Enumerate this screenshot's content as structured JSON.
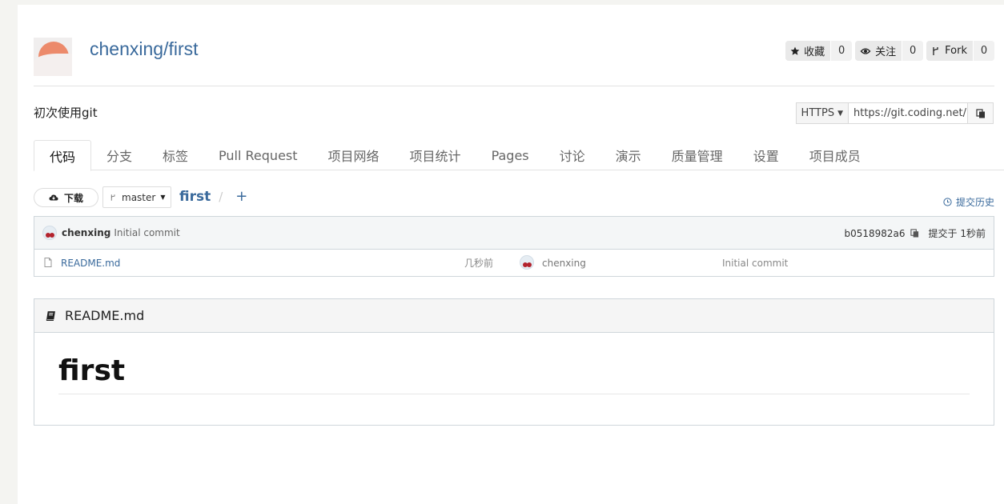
{
  "repo": {
    "owner": "chenxing",
    "name": "first",
    "title": "chenxing/first",
    "description": "初次使用git"
  },
  "counters": [
    {
      "label": "收藏",
      "count": "0",
      "icon": "star-icon"
    },
    {
      "label": "关注",
      "count": "0",
      "icon": "eye-icon"
    },
    {
      "label": "Fork",
      "count": "0",
      "icon": "fork-icon"
    }
  ],
  "clone": {
    "protocol": "HTTPS",
    "url": "https://git.coding.net/"
  },
  "tabs": [
    {
      "label": "代码",
      "active": true
    },
    {
      "label": "分支"
    },
    {
      "label": "标签"
    },
    {
      "label": "Pull Request"
    },
    {
      "label": "项目网络"
    },
    {
      "label": "项目统计"
    },
    {
      "label": "Pages"
    },
    {
      "label": "讨论"
    },
    {
      "label": "演示"
    },
    {
      "label": "质量管理"
    },
    {
      "label": "设置"
    },
    {
      "label": "项目成员"
    }
  ],
  "toolbar": {
    "download_label": "下载",
    "branch": "master",
    "path_root": "first",
    "path_sep": "/",
    "add_label": "+",
    "history_label": "提交历史"
  },
  "latest_commit": {
    "author": "chenxing",
    "message": "Initial commit",
    "sha": "b0518982a6",
    "time": "提交于 1秒前"
  },
  "files": [
    {
      "name": "README.md",
      "time": "几秒前",
      "author": "chenxing",
      "message": "Initial commit"
    }
  ],
  "readme": {
    "filename": "README.md",
    "heading": "first"
  },
  "colors": {
    "link": "#3a6a9c",
    "border": "#cfd6db",
    "avatar_sun": "#ec8a6b"
  }
}
